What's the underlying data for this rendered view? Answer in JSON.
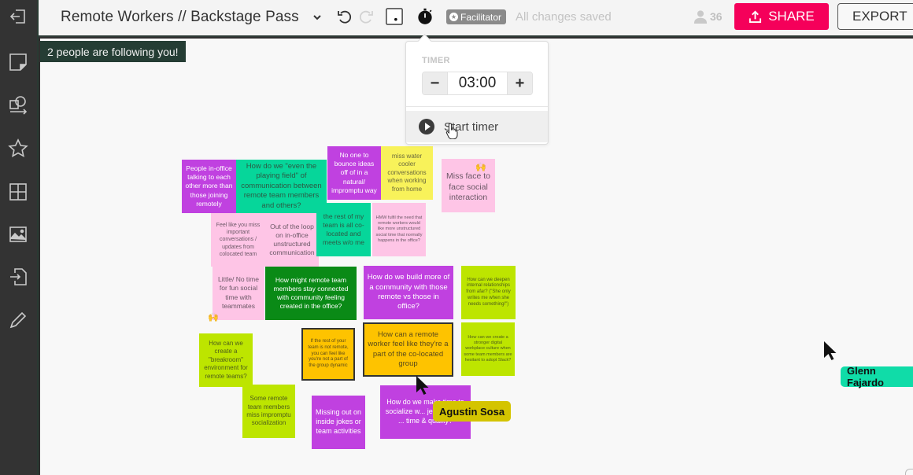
{
  "topbar": {
    "board_title": "Remote Workers // Backstage Pass",
    "facilitator_badge": "Facilitator",
    "save_status": "All changes saved",
    "user_count": "36",
    "share_label": "SHARE",
    "export_label": "EXPORT",
    "icons": {
      "title_dropdown": "chevron-down-icon",
      "undo": "undo-icon",
      "redo": "redo-icon",
      "focus_frame": "frame-icon",
      "timer": "stopwatch-icon",
      "users": "user-icon",
      "share": "upload-icon"
    }
  },
  "sidebar": {
    "items": [
      {
        "name": "exit",
        "icon": "exit-icon"
      },
      {
        "name": "sticky-note",
        "icon": "sticky-note-icon"
      },
      {
        "name": "shapes",
        "icon": "shapes-icon"
      },
      {
        "name": "favorites",
        "icon": "star-icon"
      },
      {
        "name": "templates",
        "icon": "grid-icon"
      },
      {
        "name": "images",
        "icon": "image-icon"
      },
      {
        "name": "import",
        "icon": "import-icon"
      },
      {
        "name": "draw",
        "icon": "pencil-icon"
      }
    ]
  },
  "canvas": {
    "follow_banner": "2 people are following you!",
    "timer": {
      "label": "TIMER",
      "value": "03:00",
      "decrement": "−",
      "increment": "+",
      "start_label": "Start timer"
    },
    "notes": [
      {
        "id": "n1",
        "color": "purple",
        "text": "People in-office talking to each other more than those joining remotely"
      },
      {
        "id": "n2",
        "color": "teal",
        "text": "How do we \"even the playing field\" of communication between remote team members and others?"
      },
      {
        "id": "n3",
        "color": "purple",
        "text": "No one to bounce ideas off of in a natural/ impromptu way"
      },
      {
        "id": "n4",
        "color": "yellow",
        "text": "miss water cooler conversations when working from home"
      },
      {
        "id": "n5",
        "color": "pink",
        "text": "Miss face to face social interaction",
        "votes": "2 hands"
      },
      {
        "id": "n6",
        "color": "pink",
        "text": "Feel like you miss important conversations / updates from colocated team"
      },
      {
        "id": "n7",
        "color": "pink",
        "text": "Out of the loop on in-office unstructured communication"
      },
      {
        "id": "n8",
        "color": "teal",
        "text": "the rest of my team is all co-located and meets w/o me"
      },
      {
        "id": "n9",
        "color": "pink",
        "text": "HMW fulfil the need that remote workers would like more unstructured social time that normally happens in the office?"
      },
      {
        "id": "n10",
        "color": "pink",
        "text": "Little/ No time for fun social time with teammates",
        "votes": "2 hands"
      },
      {
        "id": "n11",
        "color": "green",
        "text": "How might remote team members stay connected with community feeling created in the office?"
      },
      {
        "id": "n12",
        "color": "purple",
        "text": "How do we build more of a community with those remote vs those in office?"
      },
      {
        "id": "n13",
        "color": "lime",
        "text": "How can we deepen internal relationships from afar? (\"She only writes me when she needs something!\")"
      },
      {
        "id": "n14",
        "color": "lime",
        "text": "How can we create a \"breakroom\" environment for remote teams?"
      },
      {
        "id": "n15",
        "color": "orange",
        "text": "If the rest of your team is not remote, you can feel like you're not a part of the group dynamic"
      },
      {
        "id": "n16",
        "color": "orange",
        "text": "How can a remote worker feel like they're a part of the co-located group"
      },
      {
        "id": "n17",
        "color": "lime",
        "text": "How can we create a stronger digital workplace culture when some team members are hesitant to adopt Slack?"
      },
      {
        "id": "n18",
        "color": "lime",
        "text": "Some remote team members miss impromptu socialization"
      },
      {
        "id": "n19",
        "color": "purple",
        "text": "Missing out on inside jokes or team activities"
      },
      {
        "id": "n20",
        "color": "purple",
        "text": "How do we make time to socialize w... jeopardizing ... time & quality?"
      }
    ],
    "collaborators": [
      {
        "name": "Agustin Sosa",
        "color": "#d4c400"
      },
      {
        "name": "Glenn Fajardo",
        "color": "#10dca8"
      }
    ]
  }
}
